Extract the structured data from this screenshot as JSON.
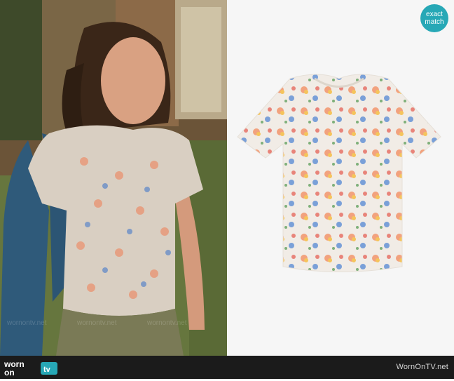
{
  "badge": {
    "line1": "exact",
    "line2": "match"
  },
  "footer": {
    "logo_word1": "worn",
    "logo_word2": "on",
    "logo_word3": "tv",
    "site_name": "WornOnTV.net"
  },
  "watermark_text": "wornontv.net",
  "colors": {
    "badge": "#27a8b6",
    "footer_bg": "#1b1b1b",
    "logo_accent": "#27a8b6"
  }
}
